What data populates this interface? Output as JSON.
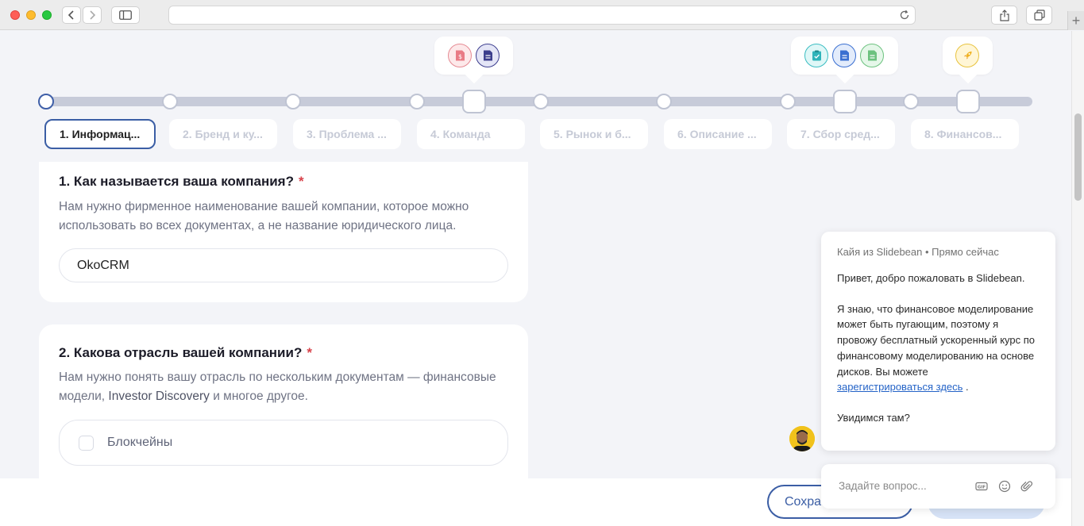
{
  "steps": [
    {
      "label": "1. Информац..."
    },
    {
      "label": "2. Бренд и ку..."
    },
    {
      "label": "3. Проблема ..."
    },
    {
      "label": "4. Команда"
    },
    {
      "label": "5. Рынок и б..."
    },
    {
      "label": "6. Описание ..."
    },
    {
      "label": "7. Сбор сред..."
    },
    {
      "label": "8. Финансов..."
    }
  ],
  "question1": {
    "title": "1. Как называется ваша компания?",
    "required_mark": "*",
    "desc": "Нам нужно фирменное наименование вашей компании, которое можно использовать во всех документах, а не название юридического лица.",
    "value": "OkoCRM"
  },
  "question2": {
    "title": "2. Какова отрасль вашей компании?",
    "required_mark": "*",
    "desc_part1": "Нам нужно понять вашу отрасль по нескольким документам — финансовые модели,",
    "desc_highlight": "Investor Discovery",
    "desc_part2": "и многое другое.",
    "option1": "Блокчейны"
  },
  "footer": {
    "save_label": "Сохра"
  },
  "chat": {
    "meta": "Кайя из Slidebean • Прямо сейчас",
    "greeting": "Привет, добро пожаловать в Slidebean.",
    "message": "Я знаю, что финансовое моделирование может быть пугающим, поэтому я провожу бесплатный ускоренный курс по финансовому моделированию на основе дисков. Вы можете",
    "link": "зарегистрироваться здесь",
    "link_tail": ".",
    "closing": "Увидимся там?",
    "input_placeholder": "Задайте вопрос..."
  },
  "colors": {
    "accent": "#3b5ea5",
    "required": "#d8424a",
    "link": "#2463c7"
  }
}
